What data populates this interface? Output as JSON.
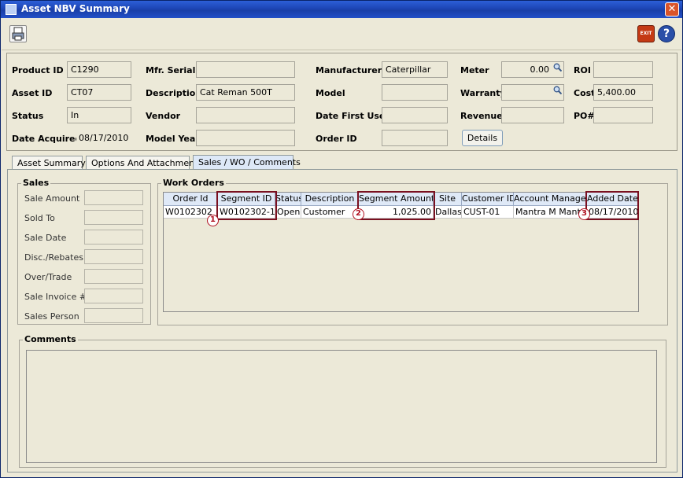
{
  "window": {
    "title": "Asset NBV Summary",
    "close_glyph": "✕"
  },
  "toolbar": {
    "exit_label": "EXIT",
    "help_label": "?"
  },
  "asset": {
    "labels": {
      "product_id": "Product ID",
      "asset_id": "Asset ID",
      "status": "Status",
      "date_acquired": "Date Acquired",
      "mfr_serial": "Mfr. Serial",
      "description": "Description",
      "vendor": "Vendor",
      "model_year": "Model Year",
      "manufacturer": "Manufacturer",
      "model": "Model",
      "date_first_used": "Date First Used",
      "order_id": "Order ID",
      "meter": "Meter",
      "warranty": "Warranty",
      "revenue": "Revenue",
      "roi": "ROI",
      "cost": "Cost",
      "po": "PO#"
    },
    "values": {
      "product_id": "C1290",
      "asset_id": "CT07",
      "status": "In",
      "date_acquired": "08/17/2010",
      "mfr_serial": "",
      "description": "Cat Reman 500T",
      "vendor": "",
      "model_year": "",
      "manufacturer": "Caterpillar",
      "model": "",
      "date_first_used": "",
      "order_id": "",
      "meter": "0.00",
      "warranty": "",
      "revenue": "",
      "roi": "",
      "cost": "5,400.00",
      "po": ""
    },
    "details_button": "Details"
  },
  "tabs": [
    {
      "label": "Asset Summary",
      "active": false
    },
    {
      "label": "Options And Attachments",
      "active": false
    },
    {
      "label": "Sales / WO / Comments",
      "active": true
    }
  ],
  "sales": {
    "title": "Sales",
    "fields": [
      "Sale Amount",
      "Sold To",
      "Sale Date",
      "Disc./Rebates",
      "Over/Trade",
      "Sale Invoice #",
      "Sales Person"
    ]
  },
  "work_orders": {
    "title": "Work Orders",
    "columns": [
      "Order Id",
      "Segment ID",
      "Status",
      "Description",
      "Segment Amount",
      "Site",
      "Customer ID",
      "Account Manager",
      "Added Date"
    ],
    "rows": [
      [
        "W0102302",
        "W0102302-1",
        "Open",
        "Customer",
        "1,025.00",
        "Dallas",
        "CUST-01",
        "Mantra M Mantra",
        "08/17/2010"
      ]
    ]
  },
  "callouts": [
    "1",
    "2",
    "3"
  ],
  "comments": {
    "title": "Comments",
    "value": ""
  },
  "colors": {
    "title_bar": "#1d45b5",
    "highlight": "#7a1020",
    "header_bg": "#dfe9f7"
  }
}
